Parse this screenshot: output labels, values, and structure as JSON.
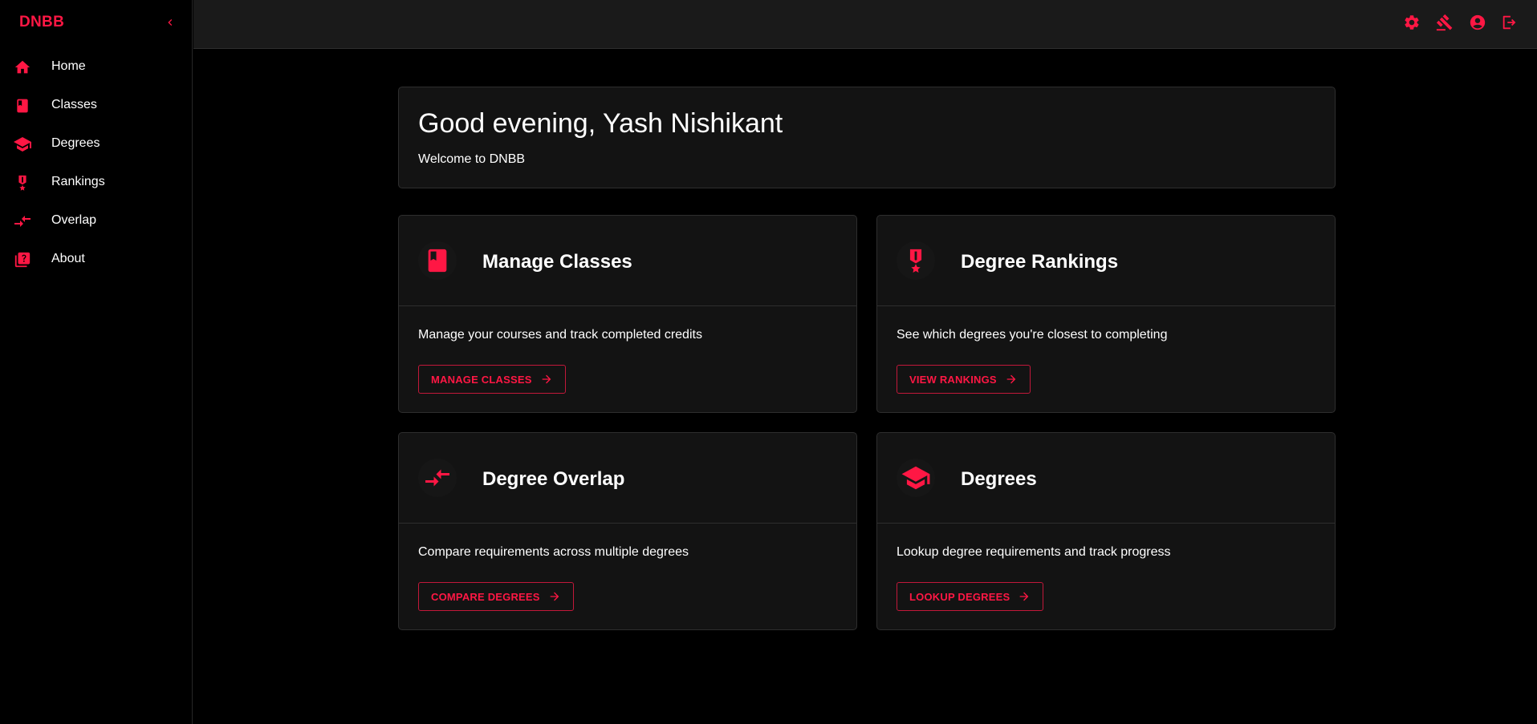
{
  "colors": {
    "accent": "#ff1744",
    "background": "#000000",
    "surface": "#131313",
    "topbar": "#1a1a1a",
    "border": "#2e2e2e"
  },
  "sidebar": {
    "brand": "DNBB",
    "collapse_icon": "chevron-left-icon",
    "items": [
      {
        "label": "Home",
        "icon": "home-icon"
      },
      {
        "label": "Classes",
        "icon": "book-icon"
      },
      {
        "label": "Degrees",
        "icon": "graduation-cap-icon"
      },
      {
        "label": "Rankings",
        "icon": "medal-icon"
      },
      {
        "label": "Overlap",
        "icon": "compare-arrows-icon"
      },
      {
        "label": "About",
        "icon": "help-book-icon"
      }
    ]
  },
  "topbar": {
    "icons": [
      "gear-icon",
      "gavel-icon",
      "account-circle-icon",
      "logout-icon"
    ]
  },
  "welcome": {
    "greeting": "Good evening, Yash Nishikant",
    "subtitle": "Welcome to DNBB"
  },
  "cards": [
    {
      "title": "Manage Classes",
      "icon": "book-icon",
      "description": "Manage your courses and track completed credits",
      "button": "MANAGE CLASSES"
    },
    {
      "title": "Degree Rankings",
      "icon": "medal-icon",
      "description": "See which degrees you're closest to completing",
      "button": "VIEW RANKINGS"
    },
    {
      "title": "Degree Overlap",
      "icon": "compare-arrows-icon",
      "description": "Compare requirements across multiple degrees",
      "button": "COMPARE DEGREES"
    },
    {
      "title": "Degrees",
      "icon": "graduation-cap-icon",
      "description": "Lookup degree requirements and track progress",
      "button": "LOOKUP DEGREES"
    }
  ]
}
